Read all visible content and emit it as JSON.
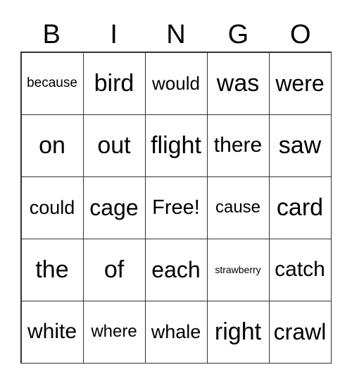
{
  "header": [
    "B",
    "I",
    "N",
    "G",
    "O"
  ],
  "cells": [
    "because",
    "bird",
    "would",
    "was",
    "were",
    "on",
    "out",
    "flight",
    "there",
    "saw",
    "could",
    "cage",
    "Free!",
    "cause",
    "card",
    "the",
    "of",
    "each",
    "strawberry",
    "catch",
    "white",
    "where",
    "whale",
    "right",
    "crawl"
  ]
}
